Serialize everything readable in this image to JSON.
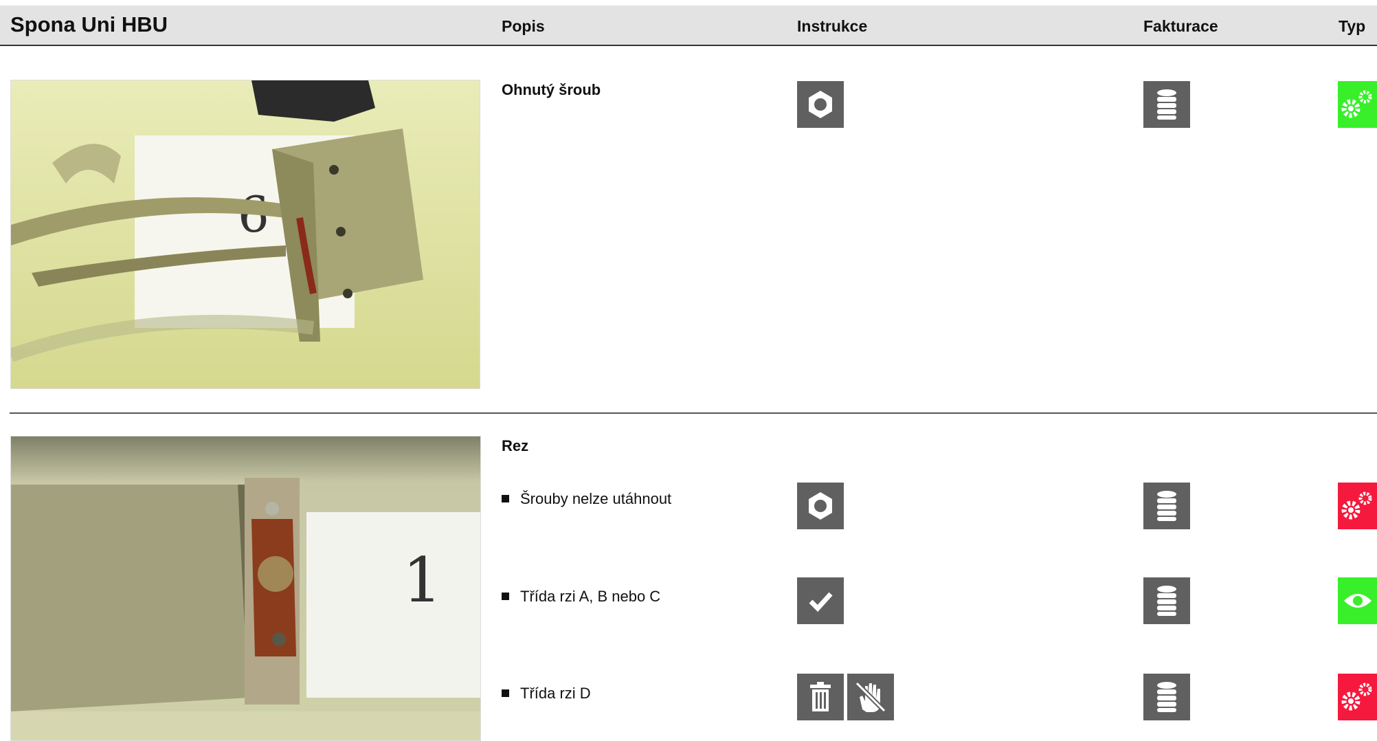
{
  "header": {
    "title": "Spona Uni HBU",
    "col_popis": "Popis",
    "col_instrukce": "Instrukce",
    "col_fakturace": "Fakturace",
    "col_typ": "Typ"
  },
  "colors": {
    "icon_bg": "#606060",
    "type_green": "#38ef2a",
    "type_red": "#f5193d",
    "header_bg": "#e3e3e3"
  },
  "rows": [
    {
      "photo_label": "6",
      "title": "Ohnutý šroub",
      "instruction_icons": [
        "nut-icon"
      ],
      "billing_icon": "coin-stack-icon",
      "type": {
        "icon": "gears-icon",
        "color": "green"
      }
    },
    {
      "photo_label": "1",
      "title": "Rez",
      "items": [
        {
          "text": "Šrouby nelze utáhnout",
          "instruction_icons": [
            "nut-icon"
          ],
          "billing_icon": "coin-stack-icon",
          "type": {
            "icon": "gears-icon",
            "color": "red"
          }
        },
        {
          "text": "Třída rzi A, B nebo C",
          "instruction_icons": [
            "check-icon"
          ],
          "billing_icon": "coin-stack-icon",
          "type": {
            "icon": "eye-icon",
            "color": "green"
          }
        },
        {
          "text": "Třída rzi D",
          "instruction_icons": [
            "trash-icon",
            "no-touch-icon"
          ],
          "billing_icon": "coin-stack-icon",
          "type": {
            "icon": "gears-icon",
            "color": "red"
          }
        }
      ]
    }
  ]
}
